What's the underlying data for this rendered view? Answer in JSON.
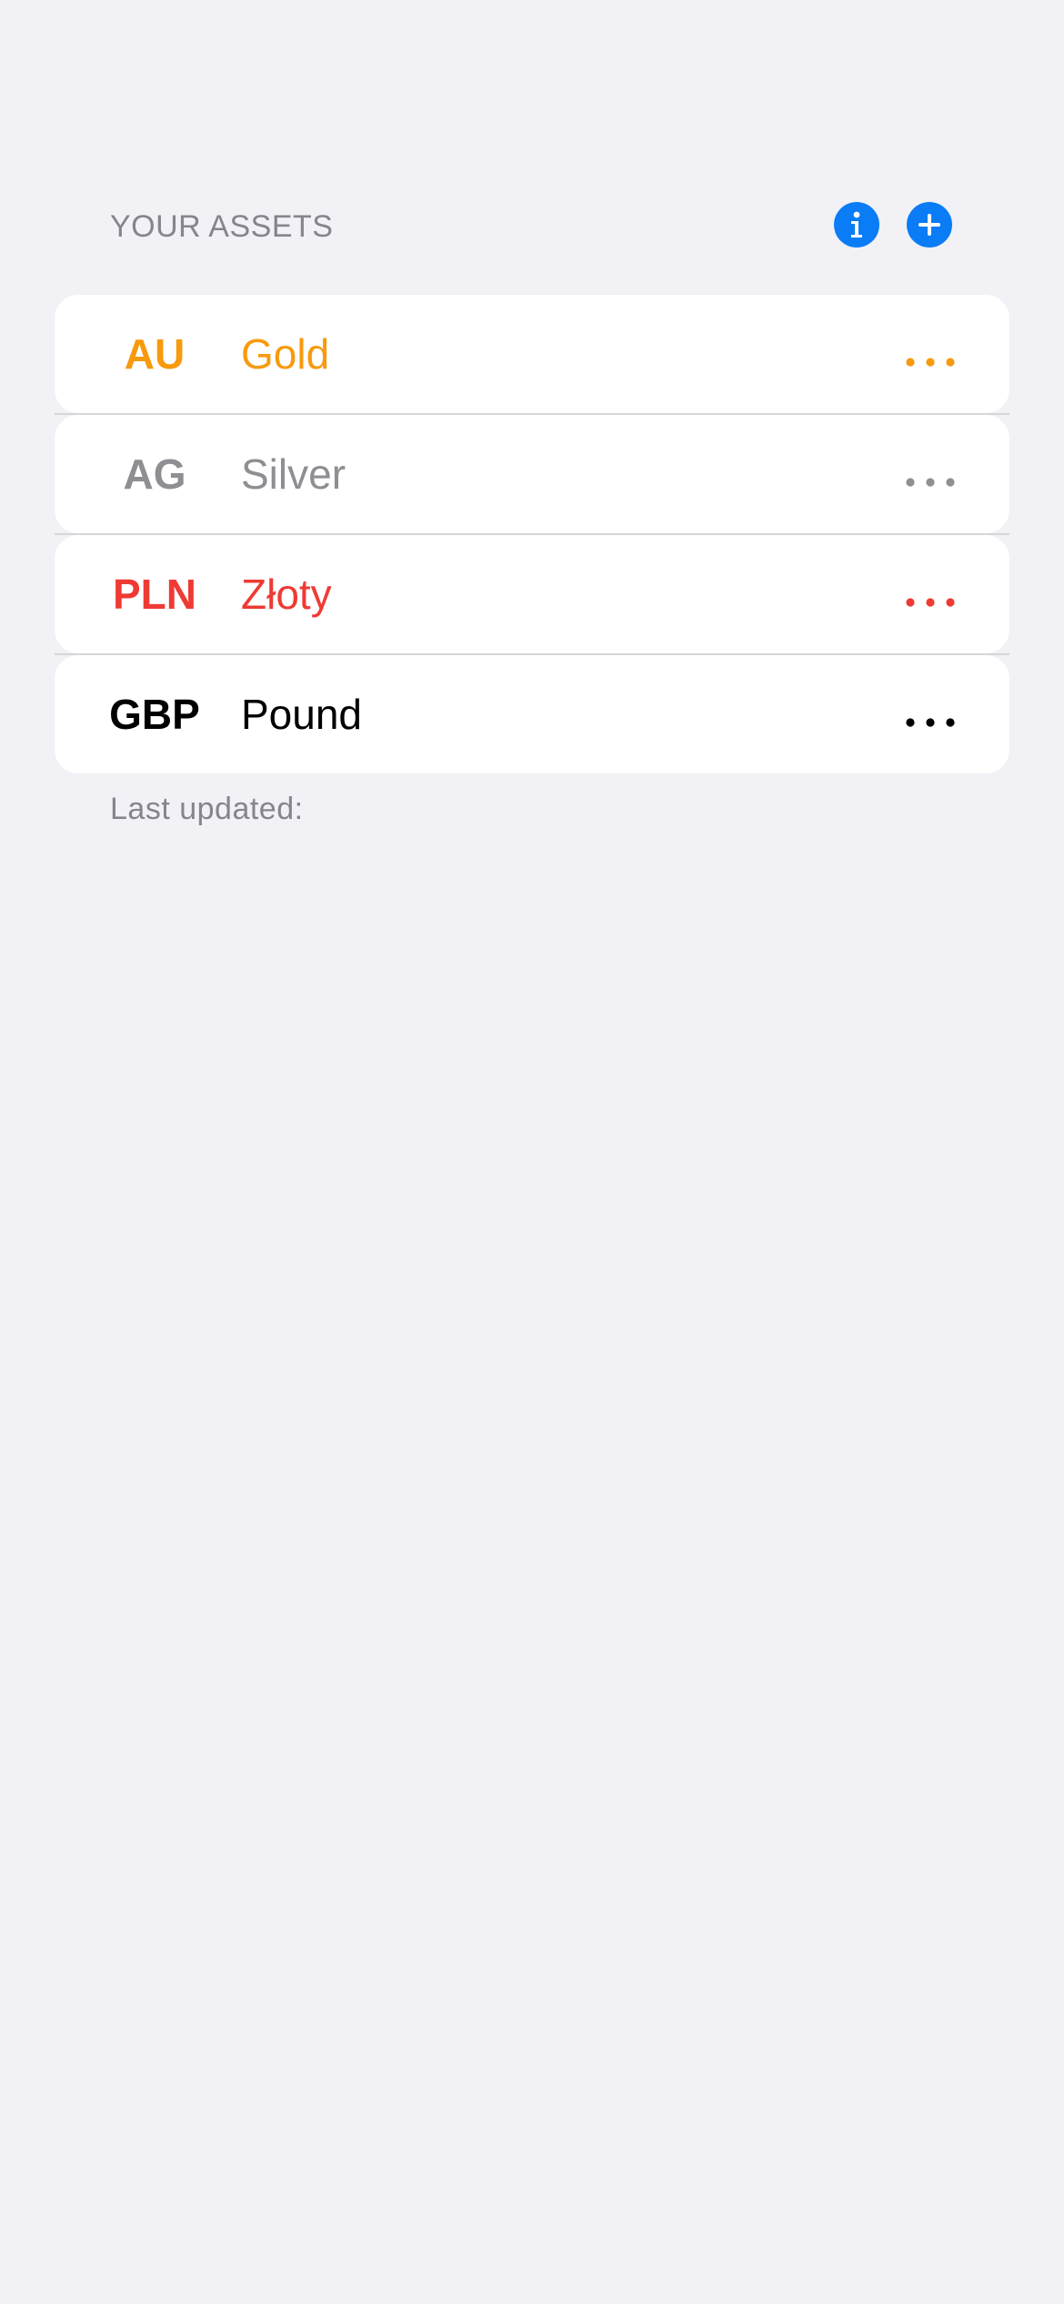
{
  "section": {
    "title": "YOUR ASSETS"
  },
  "header_buttons": {
    "info_icon": "info-circle-icon",
    "add_icon": "plus-circle-icon",
    "accent_color": "#0a7cf5"
  },
  "assets": [
    {
      "code": "AU",
      "name": "Gold",
      "color": "#f79a0e",
      "more_icon": "ellipsis-icon"
    },
    {
      "code": "AG",
      "name": "Silver",
      "color": "#8e8e93",
      "more_icon": "ellipsis-icon"
    },
    {
      "code": "PLN",
      "name": "Złoty",
      "color": "#ef3a34",
      "more_icon": "ellipsis-icon"
    },
    {
      "code": "GBP",
      "name": "Pound",
      "color": "#000000",
      "more_icon": "ellipsis-icon"
    }
  ],
  "footer": {
    "last_updated": "Last updated:"
  }
}
